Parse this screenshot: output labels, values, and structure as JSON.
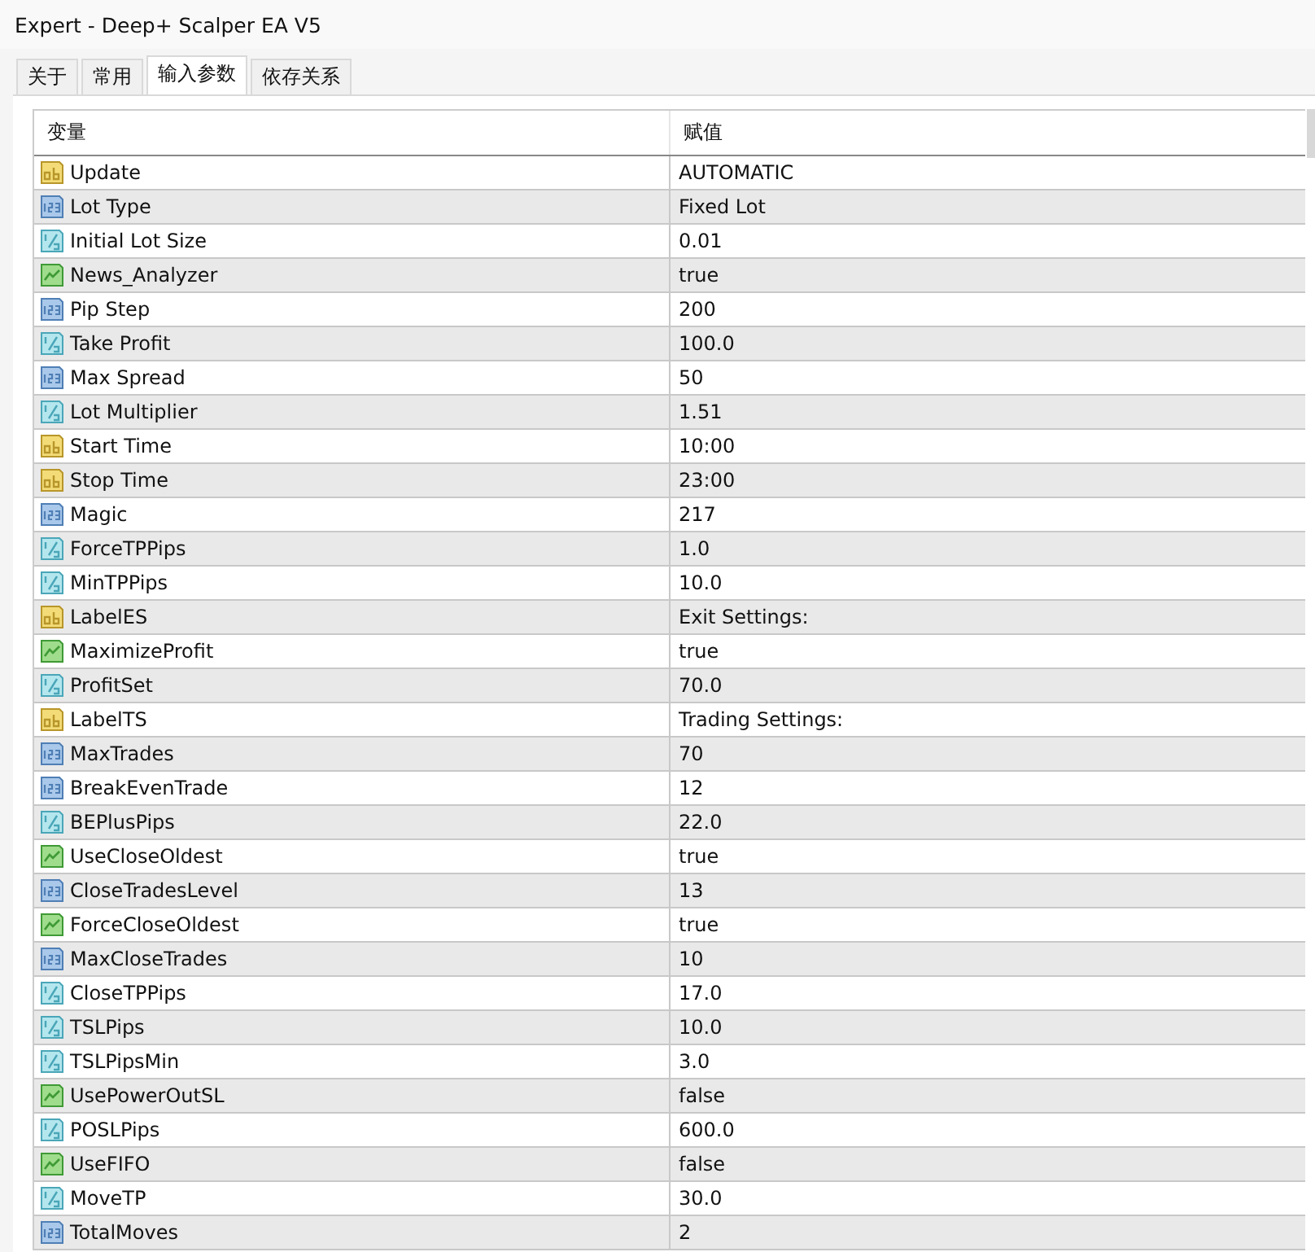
{
  "window": {
    "title": "Expert - Deep+ Scalper EA V5"
  },
  "tabs": [
    {
      "label": "关于",
      "selected": false
    },
    {
      "label": "常用",
      "selected": false
    },
    {
      "label": "输入参数",
      "selected": true
    },
    {
      "label": "依存关系",
      "selected": false
    }
  ],
  "table": {
    "columns": [
      "变量",
      "赋值"
    ],
    "rows": [
      {
        "kind": "string",
        "name": "Update",
        "value": "AUTOMATIC"
      },
      {
        "kind": "int",
        "name": "Lot Type",
        "value": "Fixed Lot"
      },
      {
        "kind": "double",
        "name": "Initial Lot Size",
        "value": "0.01"
      },
      {
        "kind": "bool",
        "name": "News_Analyzer",
        "value": "true"
      },
      {
        "kind": "int",
        "name": "Pip Step",
        "value": "200"
      },
      {
        "kind": "double",
        "name": "Take Profit",
        "value": "100.0"
      },
      {
        "kind": "int",
        "name": "Max Spread",
        "value": "50"
      },
      {
        "kind": "double",
        "name": "Lot Multiplier",
        "value": "1.51"
      },
      {
        "kind": "string",
        "name": "Start Time",
        "value": "10:00"
      },
      {
        "kind": "string",
        "name": "Stop Time",
        "value": "23:00"
      },
      {
        "kind": "int",
        "name": "Magic",
        "value": "217"
      },
      {
        "kind": "double",
        "name": "ForceTPPips",
        "value": "1.0"
      },
      {
        "kind": "double",
        "name": "MinTPPips",
        "value": "10.0"
      },
      {
        "kind": "string",
        "name": "LabelES",
        "value": "Exit Settings:"
      },
      {
        "kind": "bool",
        "name": "MaximizeProfit",
        "value": "true"
      },
      {
        "kind": "double",
        "name": "ProfitSet",
        "value": "70.0"
      },
      {
        "kind": "string",
        "name": "LabelTS",
        "value": "Trading Settings:"
      },
      {
        "kind": "int",
        "name": "MaxTrades",
        "value": "70"
      },
      {
        "kind": "int",
        "name": "BreakEvenTrade",
        "value": "12"
      },
      {
        "kind": "double",
        "name": "BEPlusPips",
        "value": "22.0"
      },
      {
        "kind": "bool",
        "name": "UseCloseOldest",
        "value": "true"
      },
      {
        "kind": "int",
        "name": "CloseTradesLevel",
        "value": "13"
      },
      {
        "kind": "bool",
        "name": "ForceCloseOldest",
        "value": "true"
      },
      {
        "kind": "int",
        "name": "MaxCloseTrades",
        "value": "10"
      },
      {
        "kind": "double",
        "name": "CloseTPPips",
        "value": "17.0"
      },
      {
        "kind": "double",
        "name": "TSLPips",
        "value": "10.0"
      },
      {
        "kind": "double",
        "name": "TSLPipsMin",
        "value": "3.0"
      },
      {
        "kind": "bool",
        "name": "UsePowerOutSL",
        "value": "false"
      },
      {
        "kind": "double",
        "name": "POSLPips",
        "value": "600.0"
      },
      {
        "kind": "bool",
        "name": "UseFIFO",
        "value": "false"
      },
      {
        "kind": "double",
        "name": "MoveTP",
        "value": "30.0"
      },
      {
        "kind": "int",
        "name": "TotalMoves",
        "value": "2"
      }
    ]
  }
}
